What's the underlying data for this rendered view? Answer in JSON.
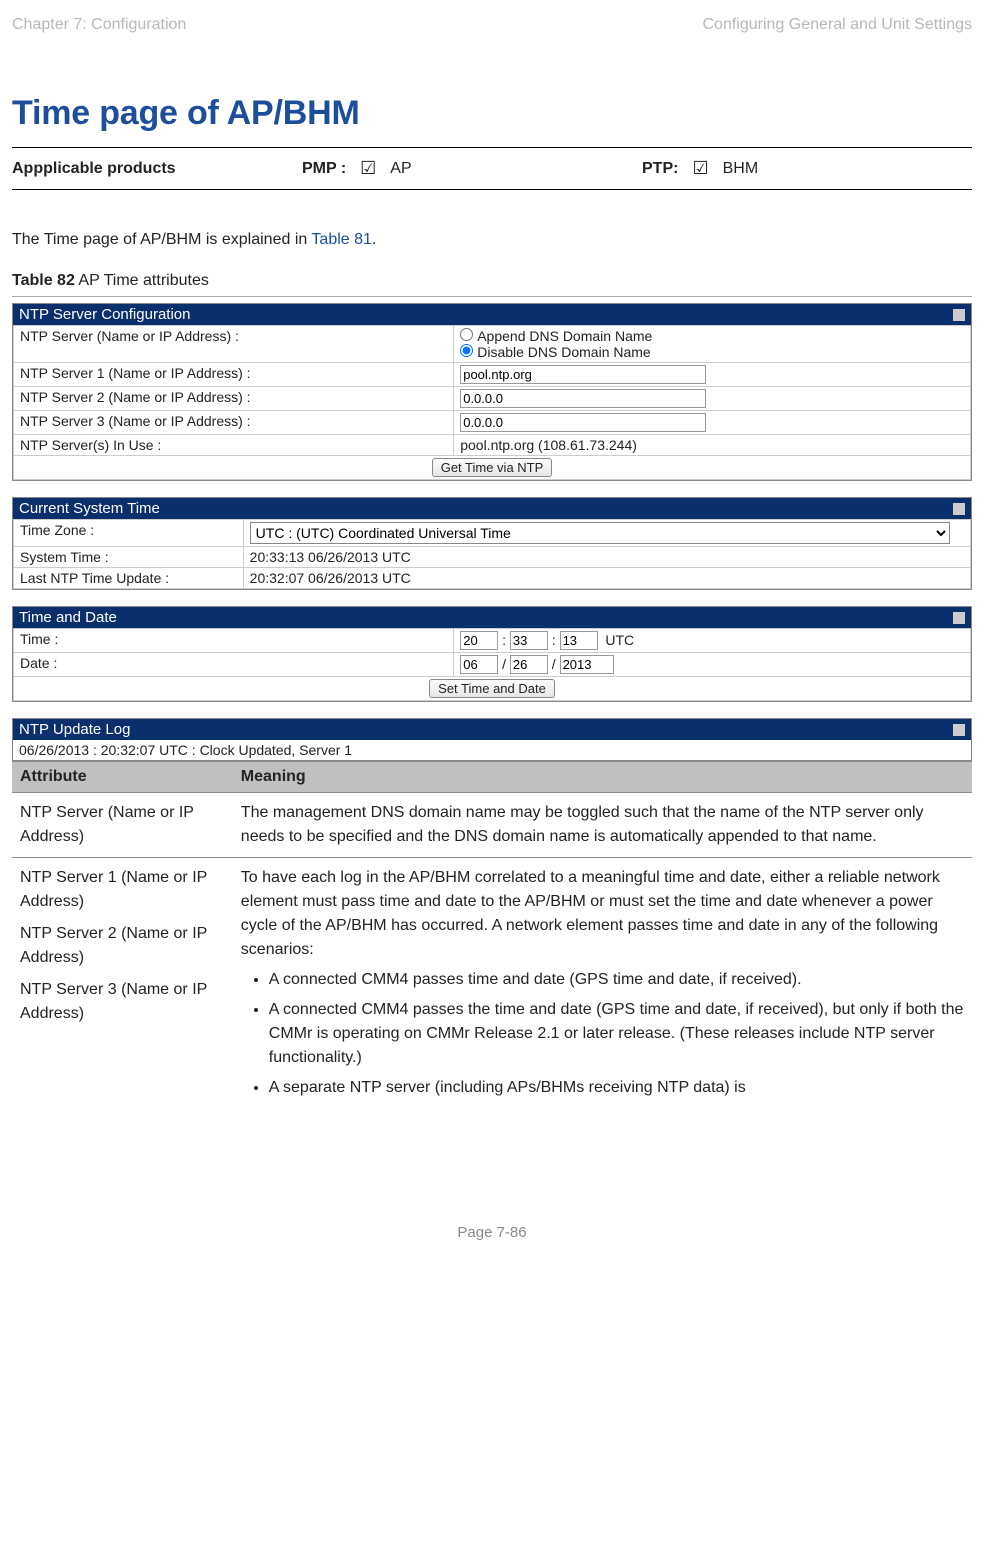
{
  "header": {
    "left": "Chapter 7:  Configuration",
    "right": "Configuring General and Unit Settings"
  },
  "section_title": "Time page of AP/BHM",
  "applicable": {
    "label": "Appplicable products",
    "pmp_label": "PMP :",
    "pmp_checked": "☑",
    "pmp_prod": "AP",
    "ptp_label": "PTP:",
    "ptp_checked": "☑",
    "ptp_prod": "BHM"
  },
  "intro": {
    "pre": "The Time page of AP/BHM is explained in ",
    "link": "Table 81",
    "post": "."
  },
  "table_caption": {
    "bold": "Table 82",
    "rest": " AP Time attributes"
  },
  "ntp_box": {
    "title": "NTP Server Configuration",
    "rows": {
      "r0_label": "NTP Server (Name or IP Address) :",
      "r0_opt1": "Append DNS Domain Name",
      "r0_opt2": "Disable DNS Domain Name",
      "r1_label": "NTP Server 1 (Name or IP Address) :",
      "r1_val": "pool.ntp.org",
      "r2_label": "NTP Server 2 (Name or IP Address) :",
      "r2_val": "0.0.0.0",
      "r3_label": "NTP Server 3 (Name or IP Address) :",
      "r3_val": "0.0.0.0",
      "r4_label": "NTP Server(s) In Use :",
      "r4_val": "pool.ntp.org (108.61.73.244)",
      "btn": "Get Time via NTP"
    }
  },
  "cst_box": {
    "title": "Current System Time",
    "tz_label": "Time Zone :",
    "tz_val": "UTC : (UTC) Coordinated Universal Time",
    "st_label": "System Time :",
    "st_val": "20:33:13 06/26/2013 UTC",
    "lu_label": "Last NTP Time Update :",
    "lu_val": "20:32:07 06/26/2013 UTC"
  },
  "td_box": {
    "title": "Time and Date",
    "time_label": "Time :",
    "h": "20",
    "m": "33",
    "s": "13",
    "tz": "UTC",
    "date_label": "Date :",
    "mo": "06",
    "da": "26",
    "yr": "2013",
    "btn": "Set Time and Date",
    "colon": ":",
    "slash": "/"
  },
  "log_box": {
    "title": "NTP Update Log",
    "entry": "06/26/2013 : 20:32:07 UTC : Clock Updated, Server 1"
  },
  "chart_data": {
    "type": "table",
    "headers": [
      "Attribute",
      "Meaning"
    ],
    "rows": [
      {
        "attribute": "NTP Server (Name or IP Address)",
        "meaning": "The management DNS domain name may be toggled such that the name of the NTP server only needs to be specified and the DNS domain name is automatically appended to that name."
      },
      {
        "attribute_lines": [
          "NTP Server 1 (Name or IP Address)",
          "NTP Server 2 (Name or IP Address)",
          "NTP Server 3 (Name or IP Address)"
        ],
        "meaning_intro": "To have each log in the AP/BHM correlated to a meaningful time and date, either a reliable network element must pass time and date to the AP/BHM or must set the time and date whenever a power cycle of the AP/BHM has occurred. A network element passes time and date in any of the following scenarios:",
        "bullets": [
          "A connected CMM4 passes time and date (GPS time and date, if received).",
          "A connected CMM4 passes the time and date (GPS time and date, if received), but only if both the CMMr is operating on CMMr Release 2.1 or later release. (These releases include NTP server functionality.)",
          "A separate NTP server (including APs/BHMs receiving NTP data) is"
        ]
      }
    ]
  },
  "footer": "Page 7-86"
}
